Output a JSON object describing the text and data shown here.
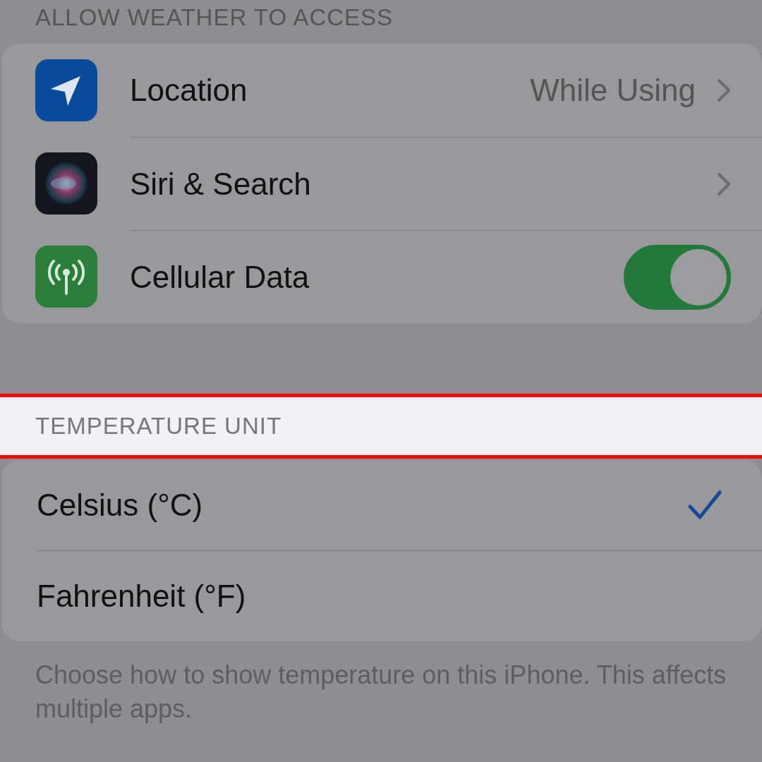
{
  "access": {
    "header": "ALLOW WEATHER TO ACCESS",
    "rows": [
      {
        "kind": "link",
        "label": "Location",
        "value": "While Using"
      },
      {
        "kind": "link",
        "label": "Siri & Search"
      },
      {
        "kind": "toggle",
        "label": "Cellular Data",
        "on": true
      }
    ]
  },
  "temperature": {
    "header": "TEMPERATURE UNIT",
    "highlighted": true,
    "options": [
      {
        "label": "Celsius (°C)",
        "selected": true
      },
      {
        "label": "Fahrenheit (°F)",
        "selected": false
      }
    ],
    "footer": "Choose how to show temperature on this iPhone. This affects multiple apps."
  }
}
